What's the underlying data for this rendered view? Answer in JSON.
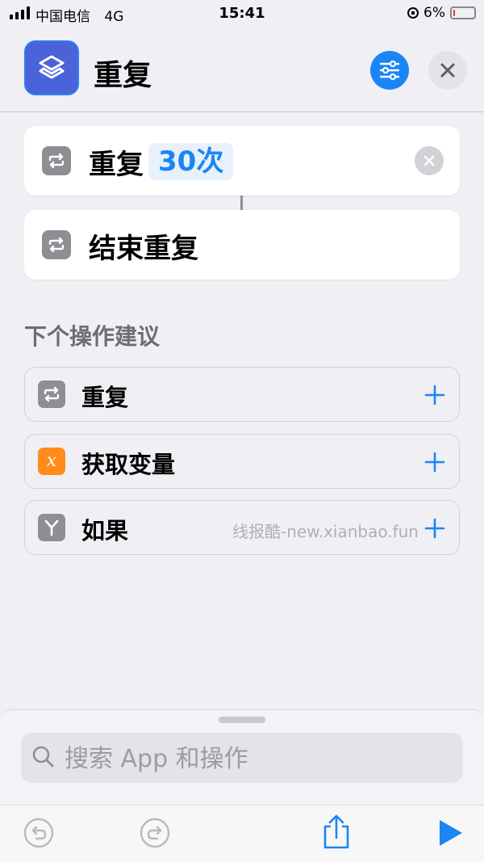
{
  "status_bar": {
    "carrier": "中国电信",
    "network": "4G",
    "time": "15:41",
    "battery_percent": "6%",
    "battery_level": 0.06
  },
  "header": {
    "title": "重复",
    "app_icon": "layers-icon",
    "settings_icon": "sliders-icon",
    "close_icon": "close-icon"
  },
  "actions": {
    "repeat": {
      "label": "重复",
      "count": "30次",
      "icon": "repeat-icon"
    },
    "end_repeat": {
      "label": "结束重复",
      "icon": "repeat-icon"
    }
  },
  "suggestions": {
    "title": "下个操作建议",
    "items": [
      {
        "label": "重复",
        "icon": "repeat-icon",
        "icon_color": "#8e8e93"
      },
      {
        "label": "获取变量",
        "icon": "variable-icon",
        "icon_color": "#ff8c1a"
      },
      {
        "label": "如果",
        "icon": "branch-icon",
        "icon_color": "#8e8e93"
      }
    ]
  },
  "watermark": "线报酷-new.xianbao.fun",
  "search": {
    "placeholder": "搜索 App 和操作"
  },
  "toolbar": {
    "icons": [
      "undo-icon",
      "redo-icon",
      "share-icon",
      "play-icon"
    ]
  },
  "colors": {
    "accent": "#1a86f5",
    "background": "#efeff4",
    "battery_low": "#e3352d",
    "variable_orange": "#ff8c1a"
  }
}
